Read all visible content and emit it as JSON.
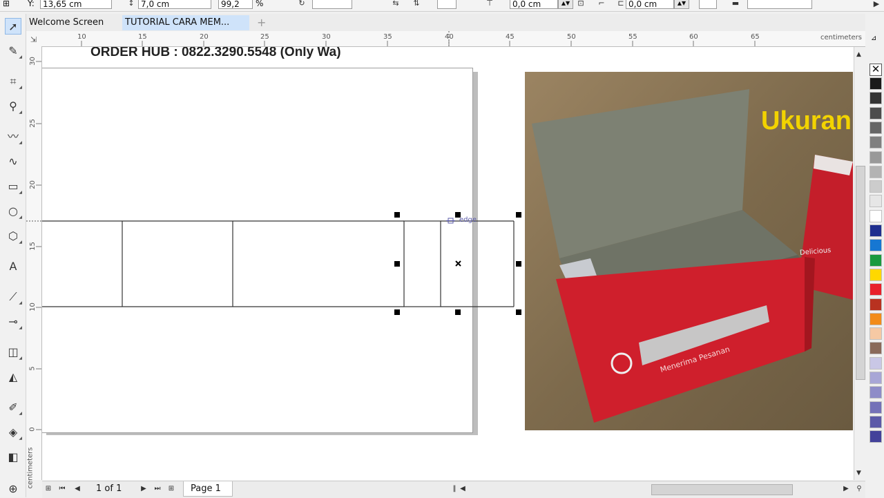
{
  "property_bar": {
    "y_label": "Y:",
    "y_value": "13,65 cm",
    "height_value": "7,0 cm",
    "scale_value": "99,2",
    "scale_unit": "%",
    "offset_x_value": "0,0 cm",
    "offset_y_value": "0,0 cm"
  },
  "tabs": {
    "welcome": "Welcome Screen",
    "document": "TUTORIAL CARA MEM...",
    "add": "+"
  },
  "ruler": {
    "unit": "centimeters",
    "h_ticks": [
      "10",
      "15",
      "20",
      "25",
      "30",
      "35",
      "40",
      "45",
      "50",
      "55",
      "60",
      "65"
    ],
    "v_ticks": [
      "30",
      "25",
      "20",
      "15",
      "10",
      "5",
      "0"
    ]
  },
  "canvas": {
    "order_text": "ORDER HUB : 0822.3290.5548 (Only Wa)",
    "photo_caption": "Ukuran",
    "snap_label": "edge",
    "box_text": "Menerima Pesanan",
    "box_side_text": "Delicious"
  },
  "bottom_bar": {
    "page_count": "1 of 1",
    "page_tab": "Page 1"
  },
  "colors": {
    "accent": "#cfe3fa",
    "box_red": "#c8202e",
    "caption_yellow": "#f2d300"
  },
  "palette": [
    "#1a1a1a",
    "#333333",
    "#4d4d4d",
    "#666666",
    "#808080",
    "#999999",
    "#b3b3b3",
    "#cccccc",
    "#e6e6e6",
    "#ffffff",
    "#1f2f8f",
    "#1677d2",
    "#1a9a3f",
    "#ffd800",
    "#e8202a",
    "#b83220",
    "#f28c1a",
    "#f6c9a4",
    "#8a6a5a",
    "#c9c7e6",
    "#a8a6d6",
    "#8e8cc8",
    "#7471b8",
    "#5b59a8",
    "#43419a"
  ]
}
